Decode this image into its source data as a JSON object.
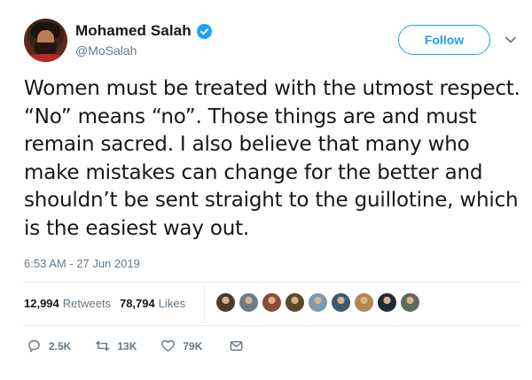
{
  "user": {
    "display_name": "Mohamed Salah",
    "handle": "@MoSalah",
    "verified": true
  },
  "follow_button": {
    "label": "Follow"
  },
  "tweet": {
    "text": "Women must be treated with the utmost respect. “No” means “no”. Those things are and must remain sacred. I also believe that many who make mistakes can change for the better and shouldn’t be sent straight to the guillotine, which is the easiest way out.",
    "timestamp": "6:53 AM - 27 Jun 2019"
  },
  "stats": {
    "retweets_count": "12,994",
    "retweets_label": "Retweets",
    "likes_count": "78,794",
    "likes_label": "Likes"
  },
  "likers": [
    {
      "color": "#4a3a30"
    },
    {
      "color": "#6b7b8a"
    },
    {
      "color": "#8a4b3a"
    },
    {
      "color": "#5a4a2a"
    },
    {
      "color": "#7a9ab0"
    },
    {
      "color": "#3d5a6e"
    },
    {
      "color": "#b08a50"
    },
    {
      "color": "#1f2a3a"
    },
    {
      "color": "#5f6a5a"
    }
  ],
  "actions": {
    "reply_count": "2.5K",
    "retweet_count": "13K",
    "like_count": "79K",
    "icons": [
      "reply-icon",
      "retweet-icon",
      "heart-icon",
      "message-icon"
    ]
  },
  "colors": {
    "accent": "#1da1f2",
    "text": "#14171a",
    "secondary": "#657786",
    "divider": "#e6ecf0"
  }
}
